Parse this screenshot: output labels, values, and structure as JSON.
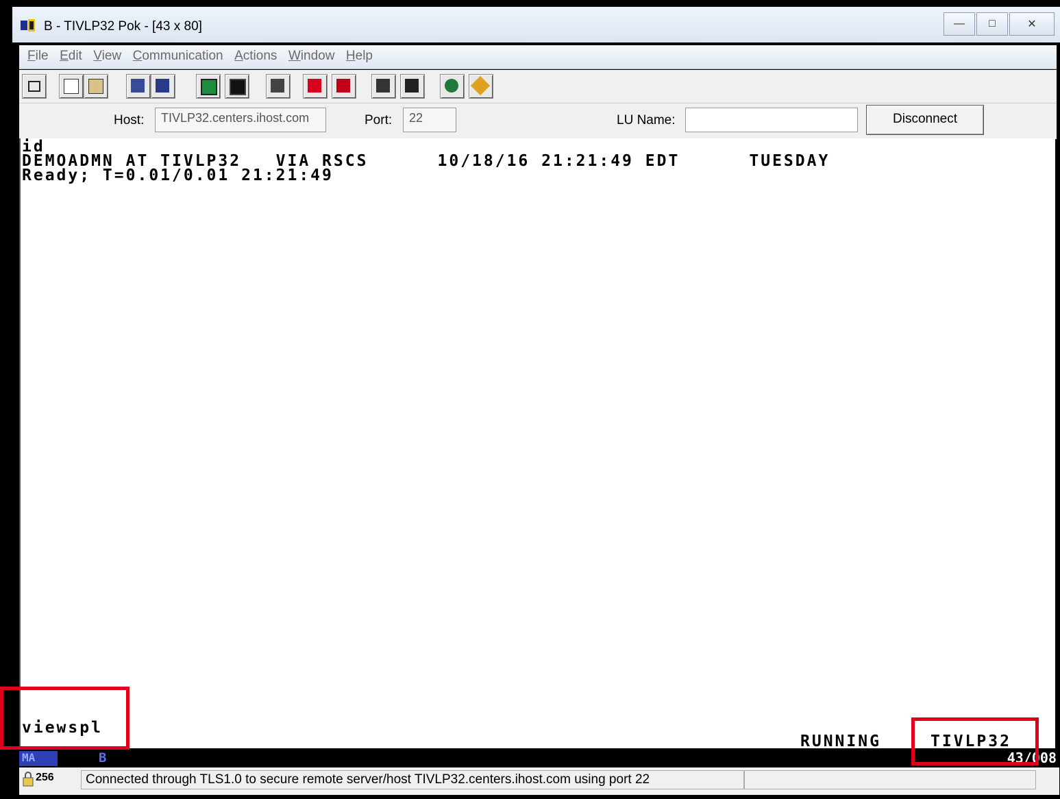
{
  "window": {
    "title": "B - TIVLP32 Pok - [43 x 80]"
  },
  "menu": [
    "File",
    "Edit",
    "View",
    "Communication",
    "Actions",
    "Window",
    "Help"
  ],
  "menu_underline": [
    "F",
    "E",
    "V",
    "C",
    "A",
    "W",
    "H"
  ],
  "toolbar": {
    "icons": [
      "display-icon",
      "copy-icon",
      "paste-icon",
      "send-file-icon",
      "receive-file-icon",
      "keypad-icon",
      "macro-icon",
      "keyboard-icon",
      "record-macro-icon",
      "stop-macro-icon",
      "play-macro-icon",
      "playback-icon",
      "globe-icon",
      "tag-icon"
    ]
  },
  "connection": {
    "host_label": "Host:",
    "host_value": "TIVLP32.centers.ihost.com",
    "port_label": "Port:",
    "port_value": "22",
    "lu_label": "LU Name:",
    "lu_value": "",
    "disconnect_label": "Disconnect"
  },
  "terminal": {
    "line1": "id",
    "line2": "DEMOADMN AT TIVLP32   VIA RSCS      10/18/16 21:21:49 EDT      TUESDAY",
    "line3": "Ready; T=0.01/0.01 21:21:49",
    "command": "viewspl",
    "status": "RUNNING",
    "system": "TIVLP32"
  },
  "oia": {
    "mode": "MA",
    "session": "B",
    "cursor": "43/008"
  },
  "statusbar": {
    "encryption": "256",
    "message": "Connected through TLS1.0 to secure remote server/host TIVLP32.centers.ihost.com using port 22"
  },
  "highlight_color": "#e0001a"
}
